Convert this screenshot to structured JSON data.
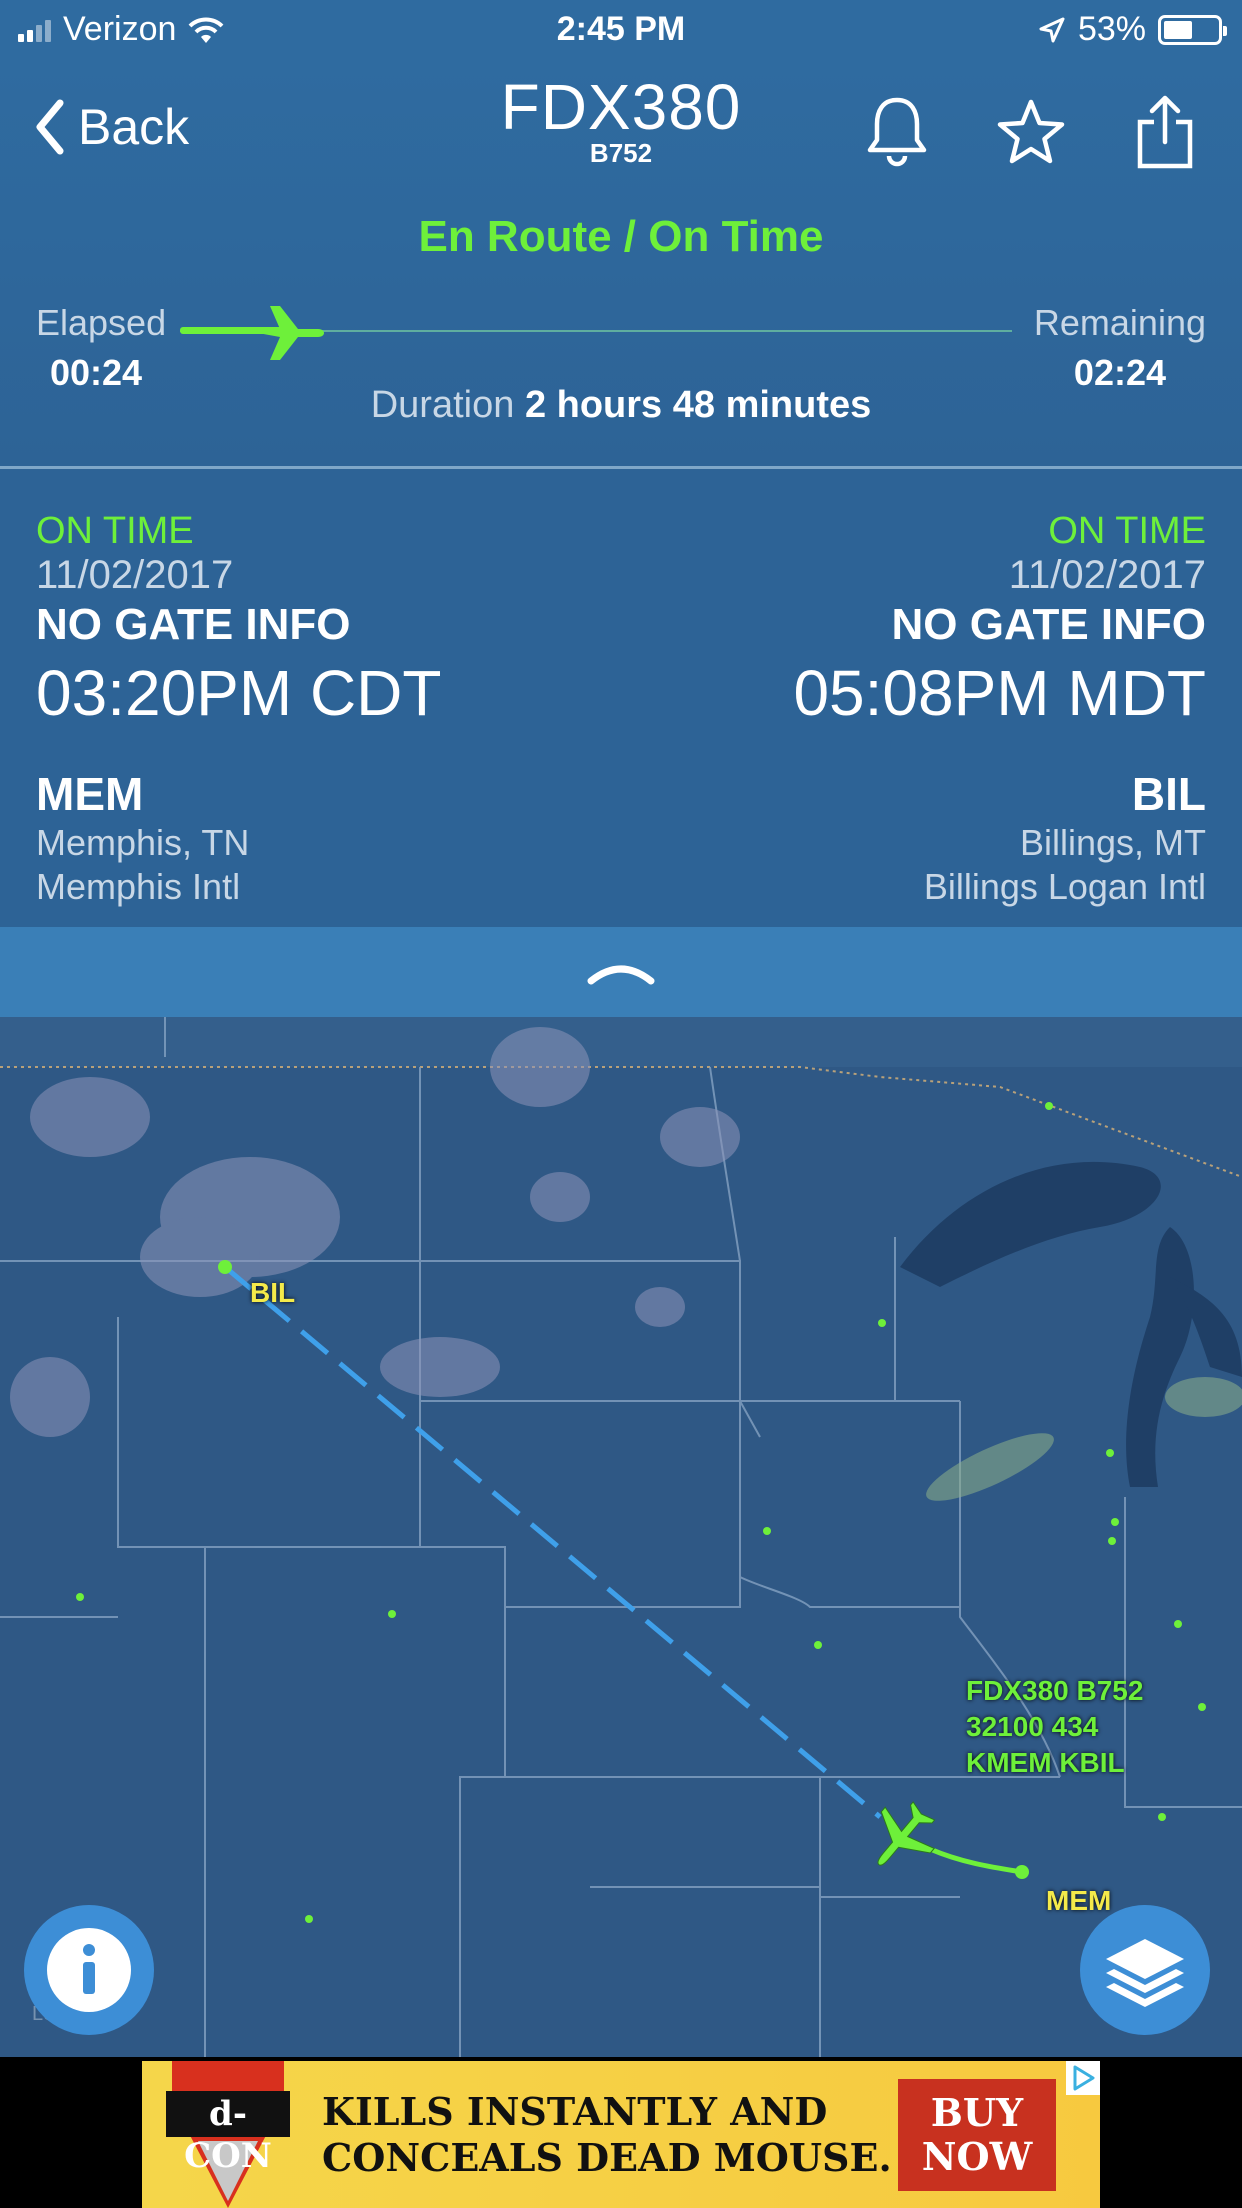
{
  "status_bar": {
    "carrier": "Verizon",
    "time": "2:45 PM",
    "battery": "53%",
    "battery_level": 0.53
  },
  "header": {
    "back_label": "Back",
    "flight_number": "FDX380",
    "aircraft_type": "B752",
    "status": "En Route / On Time",
    "elapsed_label": "Elapsed",
    "elapsed_value": "00:24",
    "remaining_label": "Remaining",
    "remaining_value": "02:24",
    "progress_fraction": 0.14,
    "duration_label": "Duration",
    "duration_value": "2 hours 48 minutes"
  },
  "departure": {
    "status": "ON TIME",
    "date": "11/02/2017",
    "gate": "NO GATE INFO",
    "time": "03:20PM CDT",
    "code": "MEM",
    "city": "Memphis, TN",
    "airport": "Memphis Intl"
  },
  "arrival": {
    "status": "ON TIME",
    "date": "11/02/2017",
    "gate": "NO GATE INFO",
    "time": "05:08PM MDT",
    "code": "BIL",
    "city": "Billings, MT",
    "airport": "Billings Logan Intl"
  },
  "map": {
    "origin_label": "MEM",
    "destination_label": "BIL",
    "flight_tag_line1": "FDX380 B752",
    "flight_tag_line2": "32100 434",
    "flight_tag_line3": "KMEM KBIL",
    "legal": "Legal"
  },
  "ad": {
    "brand": "d-CON",
    "headline_line1": "KILLS INSTANTLY AND",
    "headline_line2": "CONCEALS DEAD MOUSE.",
    "cta_line1": "BUY",
    "cta_line2": "NOW"
  },
  "colors": {
    "accent_green": "#6ef03a",
    "header_blue": "#2f6ba0",
    "map_blue": "#2f5885",
    "label_yellow": "#f4ea4a",
    "fab_blue": "#3d8ed6"
  }
}
